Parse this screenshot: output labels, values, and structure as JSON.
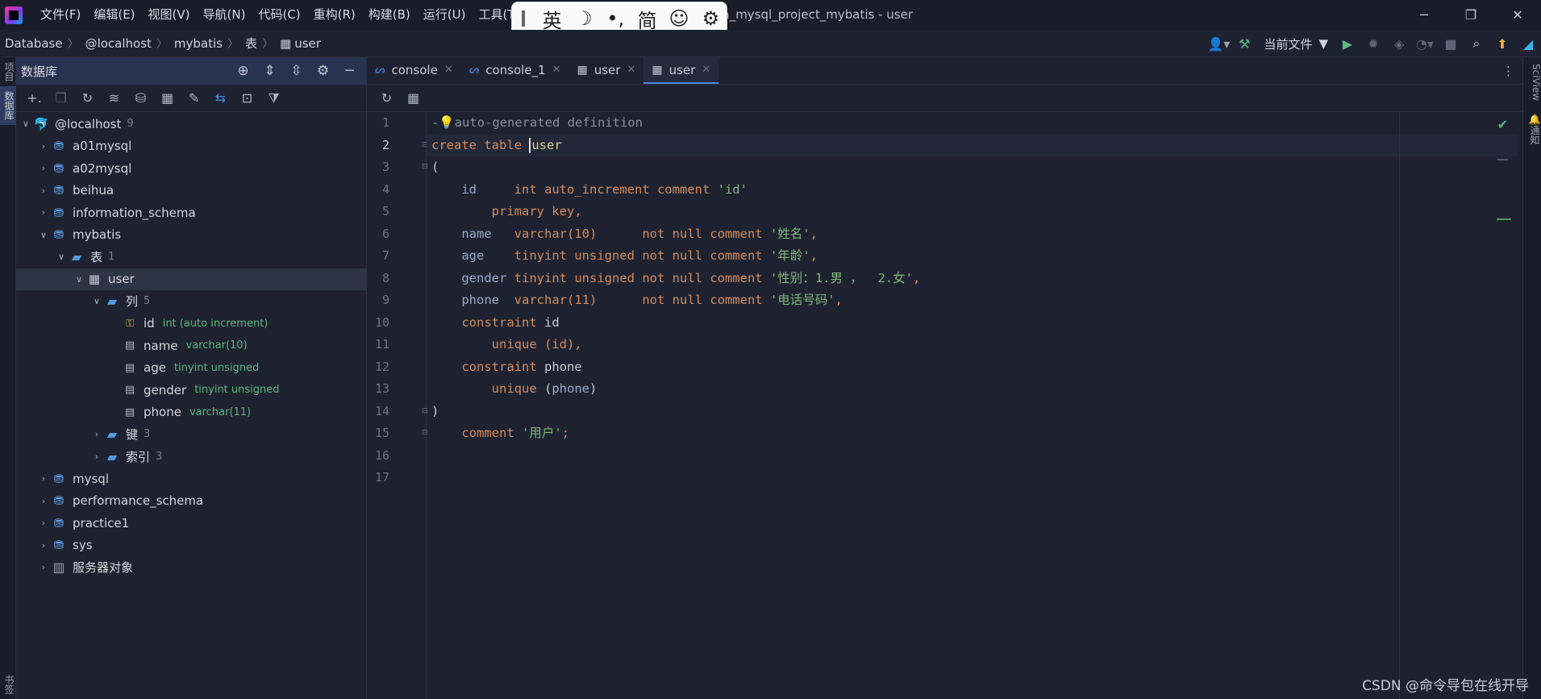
{
  "titlebar": {
    "menu": [
      "文件(F)",
      "编辑(E)",
      "视图(V)",
      "导航(N)",
      "代码(C)",
      "重构(R)",
      "构建(B)",
      "运行(U)",
      "工具(T)"
    ],
    "title": "na_mysql_project_mybatis - user",
    "minimize": "─",
    "restore": "❐",
    "close": "✕"
  },
  "ime": {
    "lang": "英",
    "moon": "☽",
    "punct": "•,",
    "script": "简",
    "emoji": "☺",
    "settings": "⚙"
  },
  "navbar": {
    "crumbs": [
      "Database",
      "@localhost",
      "mybatis",
      "表",
      "user"
    ],
    "run_config": "当前文件"
  },
  "left_strip": {
    "project": "项目",
    "database": "数据库",
    "bookmarks": "书签"
  },
  "db_panel": {
    "title": "数据库"
  },
  "tree": {
    "host": {
      "label": "@localhost",
      "count": "9"
    },
    "databases": [
      "a01mysql",
      "a02mysql",
      "beihua",
      "information_schema",
      "mybatis"
    ],
    "tables_folder": {
      "label": "表",
      "count": "1"
    },
    "table": "user",
    "columns_folder": {
      "label": "列",
      "count": "5"
    },
    "columns": [
      {
        "name": "id",
        "type": "int (auto increment)"
      },
      {
        "name": "name",
        "type": "varchar(10)"
      },
      {
        "name": "age",
        "type": "tinyint unsigned"
      },
      {
        "name": "gender",
        "type": "tinyint unsigned"
      },
      {
        "name": "phone",
        "type": "varchar(11)"
      }
    ],
    "keys_folder": {
      "label": "键",
      "count": "3"
    },
    "index_folder": {
      "label": "索引",
      "count": "3"
    },
    "other_dbs": [
      "mysql",
      "performance_schema",
      "practice1",
      "sys"
    ],
    "server_objects": "服务器对象"
  },
  "tabs": [
    {
      "label": "console",
      "kind": "console"
    },
    {
      "label": "console_1",
      "kind": "console"
    },
    {
      "label": "user",
      "kind": "table"
    },
    {
      "label": "user",
      "kind": "table",
      "active": true
    }
  ],
  "editor": {
    "line_numbers": [
      "1",
      "2",
      "3",
      "4",
      "5",
      "6",
      "7",
      "8",
      "9",
      "10",
      "11",
      "12",
      "13",
      "14",
      "15",
      "16",
      "17"
    ],
    "comment": "auto-generated definition",
    "create_kw": "create table ",
    "table_name": "user",
    "open_paren": "(",
    "close_paren": ")",
    "c1_name": "id",
    "c1_def": "int auto_increment comment ",
    "c1_comment": "'id'",
    "pk": "primary key,",
    "c2_name": "name",
    "c2_type": "varchar(10)",
    "c2_def": "not null comment ",
    "c2_comment": "'姓名'",
    "c3_name": "age",
    "c3_type": "tinyint unsigned",
    "c3_def": "not null comment ",
    "c3_comment": "'年龄'",
    "c4_name": "gender",
    "c4_type": "tinyint unsigned",
    "c4_def": "not null comment ",
    "c4_comment": "'性别：1.男 ，  2.女'",
    "c5_name": "phone",
    "c5_type": "varchar(11)",
    "c5_def": "not null comment ",
    "c5_comment": "'电话号码'",
    "constraint_kw": "constraint ",
    "k1_name": "id",
    "unique_kw": "unique ",
    "k1_cols": "(id),",
    "k2_name": "phone",
    "k2_cols_open": "(",
    "k2_col": "phone",
    "k2_cols_close": ")",
    "comment_kw": "comment ",
    "table_comment": "'用户'",
    "semicolon": ";"
  },
  "right_strip": {
    "sciview": "SciView",
    "notifications": "通知"
  },
  "watermark": "CSDN @命令导包在线开导"
}
